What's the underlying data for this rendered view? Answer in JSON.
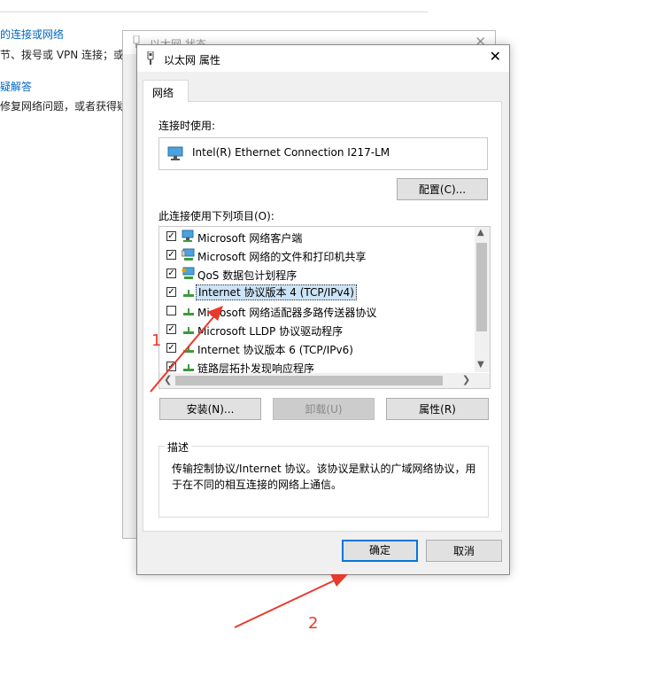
{
  "background": {
    "link1": "的连接或网络",
    "text1": "节、拨号或 VPN 连接；或者",
    "link2": "疑解答",
    "text2": "修复网络问题，或者获得疑"
  },
  "back_window": {
    "title": "以太网 状态",
    "close": "✕"
  },
  "dialog": {
    "title": "以太网 属性",
    "close": "✕",
    "tab": "网络",
    "connect_using_label": "连接时使用:",
    "adapter": "Intel(R) Ethernet Connection I217-LM",
    "configure_button": "配置(C)...",
    "items_label": "此连接使用下列项目(O):",
    "items": [
      {
        "label": "Microsoft 网络客户端",
        "checked": true,
        "icon": "network-client-icon"
      },
      {
        "label": "Microsoft 网络的文件和打印机共享",
        "checked": true,
        "icon": "file-printer-share-icon"
      },
      {
        "label": "QoS 数据包计划程序",
        "checked": true,
        "icon": "qos-icon"
      },
      {
        "label": "Internet 协议版本 4 (TCP/IPv4)",
        "checked": true,
        "icon": "protocol-icon",
        "selected": true
      },
      {
        "label": "Microsoft 网络适配器多路传送器协议",
        "checked": false,
        "icon": "protocol-icon"
      },
      {
        "label": "Microsoft LLDP 协议驱动程序",
        "checked": true,
        "icon": "protocol-icon"
      },
      {
        "label": "Internet 协议版本 6 (TCP/IPv6)",
        "checked": true,
        "icon": "protocol-icon"
      },
      {
        "label": "链路层拓扑发现响应程序",
        "checked": true,
        "icon": "protocol-icon"
      }
    ],
    "install_button": "安装(N)...",
    "uninstall_button": "卸载(U)",
    "properties_button": "属性(R)",
    "description_legend": "描述",
    "description": "传输控制协议/Internet 协议。该协议是默认的广域网络协议，用于在不同的相互连接的网络上通信。",
    "ok_button": "确定",
    "cancel_button": "取消"
  },
  "annotations": {
    "step1": "1",
    "step2": "2"
  },
  "colors": {
    "link": "#0067c0",
    "arrow": "#e8392c",
    "selection": "#cce4f7",
    "focus": "#0078d7"
  }
}
